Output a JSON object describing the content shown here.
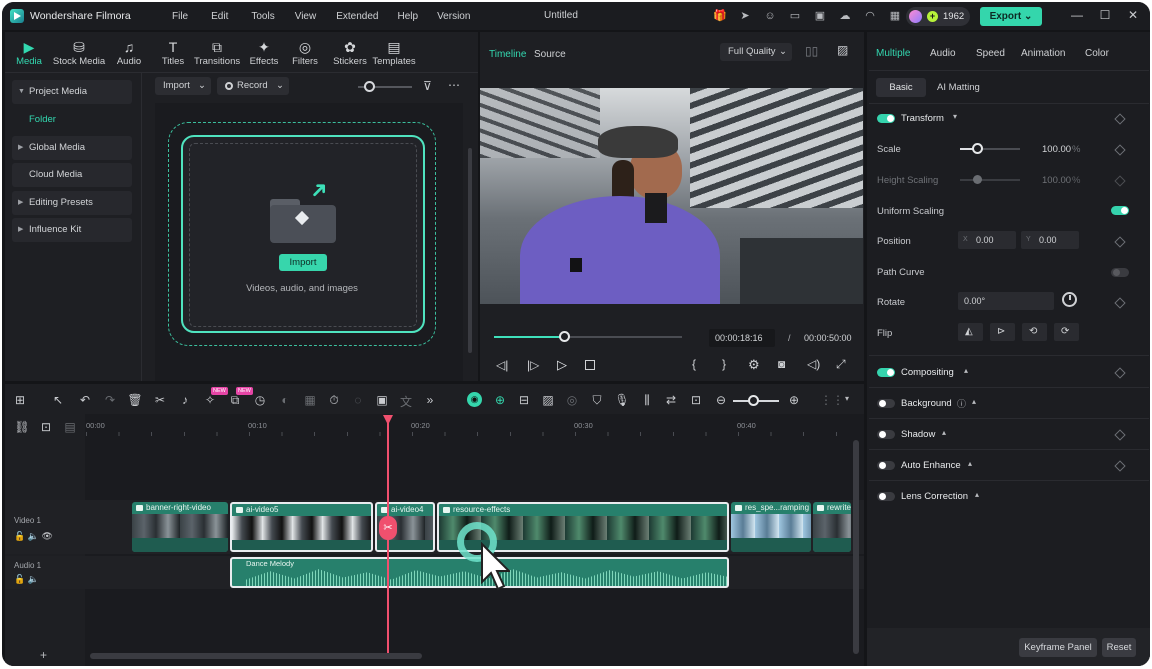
{
  "app": {
    "name": "Wondershare Filmora",
    "title": "Untitled",
    "credits": "1962",
    "export_label": "Export"
  },
  "menu": [
    "File",
    "Edit",
    "Tools",
    "View",
    "Extended",
    "Help",
    "Version"
  ],
  "toolbar": [
    "Media",
    "Stock Media",
    "Audio",
    "Titles",
    "Transitions",
    "Effects",
    "Filters",
    "Stickers",
    "Templates"
  ],
  "sidebar": [
    "Project Media",
    "Folder",
    "Global Media",
    "Cloud Media",
    "Editing Presets",
    "Influence Kit"
  ],
  "media": {
    "import_label": "Import",
    "record_label": "Record",
    "drop_button": "Import",
    "drop_hint": "Videos, audio, and images"
  },
  "preview": {
    "tab_timeline": "Timeline",
    "tab_source": "Source",
    "quality": "Full Quality",
    "current_time": "00:00:18:16",
    "separator": "/",
    "total_time": "00:00:50:00",
    "progress": 0.37
  },
  "props": {
    "tabs": [
      "Multiple",
      "Audio",
      "Speed",
      "Animation",
      "Color"
    ],
    "subtabs": [
      "Basic",
      "AI Matting"
    ],
    "transform": "Transform",
    "scale_label": "Scale",
    "scale_value": "100.00",
    "scale_unit": "%",
    "height_label": "Height Scaling",
    "height_value": "100.00",
    "height_unit": "%",
    "uniform_label": "Uniform Scaling",
    "position_label": "Position",
    "pos_x_label": "X",
    "pos_x": "0.00",
    "pos_y_label": "Y",
    "pos_y": "0.00",
    "path_label": "Path Curve",
    "rotate_label": "Rotate",
    "rotate_value": "0.00°",
    "flip_label": "Flip",
    "sections": [
      "Compositing",
      "Background",
      "Shadow",
      "Auto Enhance",
      "Lens Correction"
    ],
    "keyframe_btn": "Keyframe Panel",
    "reset_btn": "Reset"
  },
  "timeline": {
    "ticks": [
      "00:00",
      "00:10",
      "00:20",
      "00:30",
      "00:40"
    ],
    "track_video": "Video 1",
    "track_audio": "Audio 1",
    "clips": [
      "banner-right-video",
      "ai-video5",
      "ai-video4",
      "resource-effects",
      "res_spe...ramping",
      "rewrite"
    ],
    "audio_clip": "Dance Melody",
    "badges": [
      "NEW",
      "NEW"
    ]
  },
  "colors": {
    "accent": "#34d6ac",
    "playhead": "#f0506e"
  }
}
